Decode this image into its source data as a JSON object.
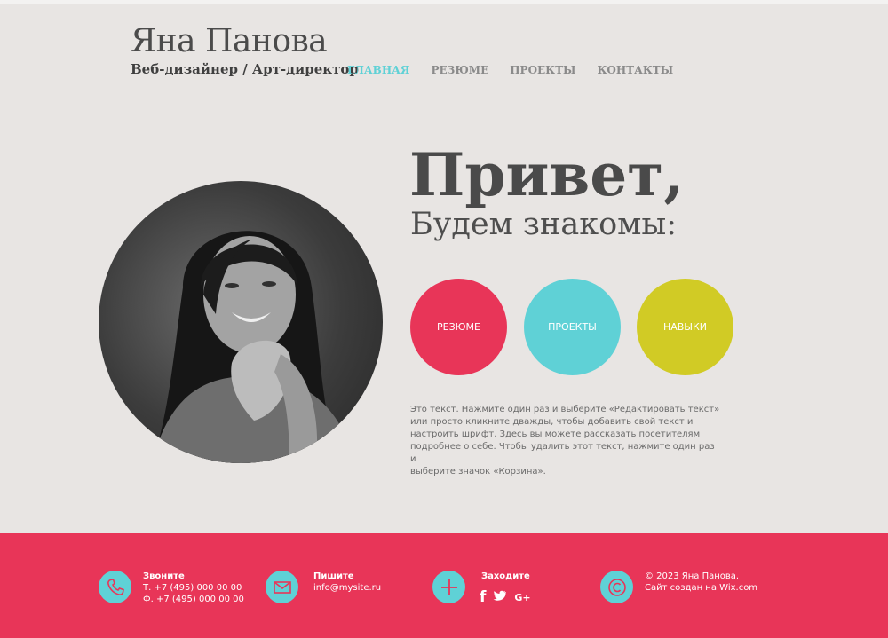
{
  "brand": {
    "name": "Яна Панова",
    "subtitle": "Веб-дизайнер / Арт-директор"
  },
  "nav": [
    {
      "label": "ГЛАВНАЯ",
      "active": true
    },
    {
      "label": "РЕЗЮМЕ",
      "active": false
    },
    {
      "label": "ПРОЕКТЫ",
      "active": false
    },
    {
      "label": "КОНТАКТЫ",
      "active": false
    }
  ],
  "hero": {
    "title": "Привет,",
    "subtitle": "Будем знакомы:",
    "buttons": [
      {
        "label": "РЕЗЮМЕ",
        "color": "#e83558"
      },
      {
        "label": "ПРОЕКТЫ",
        "color": "#5fd1d6"
      },
      {
        "label": "НАВЫКИ",
        "color": "#d1cb25"
      }
    ],
    "about_lines": [
      "Это текст. Нажмите один раз и выберите «Редактировать текст»",
      "или просто кликните дважды, чтобы добавить свой текст и",
      "настроить шрифт. Здесь вы можете рассказать посетителям",
      "подробнее о себе. Чтобы удалить этот текст, нажмите один раз и",
      "выберите значок «Корзина»."
    ]
  },
  "footer": {
    "call": {
      "title": "Звоните",
      "phone": "Т. +7 (495) 000 00 00",
      "fax": "Ф. +7 (495) 000 00 00",
      "icon": "phone-icon"
    },
    "write": {
      "title": "Пишите",
      "email": "info@mysite.ru",
      "icon": "mail-icon"
    },
    "visit": {
      "title": "Заходите",
      "icon": "plus-icon",
      "social": [
        "f",
        "twitter",
        "G+"
      ]
    },
    "copyright": {
      "line1": "© 2023 Яна Панова.",
      "line2": "Сайт создан на Wix.com",
      "icon": "copyright-icon"
    }
  },
  "colors": {
    "background": "#e8e5e3",
    "accent_red": "#e83558",
    "accent_cyan": "#5fd1d6",
    "accent_yellow": "#d1cb25"
  }
}
